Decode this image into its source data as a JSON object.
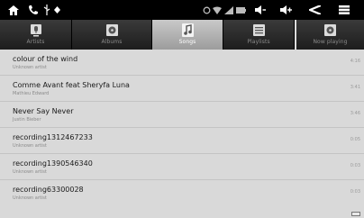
{
  "tabs": [
    {
      "label": "Artists",
      "icon": "microphone-icon"
    },
    {
      "label": "Albums",
      "icon": "album-icon"
    },
    {
      "label": "Songs",
      "icon": "music-note-icon",
      "active": true
    },
    {
      "label": "Playlists",
      "icon": "playlist-icon"
    },
    {
      "label": "Now playing",
      "icon": "now-playing-icon"
    }
  ],
  "songs": [
    {
      "title": "colour of the wind",
      "artist": "Unknown artist",
      "duration": "4:16"
    },
    {
      "title": "Comme Avant feat Sheryfa Luna",
      "artist": "Mathieu Edward",
      "duration": "3:41"
    },
    {
      "title": "Never Say Never",
      "artist": "Justin Bieber",
      "duration": "3:46"
    },
    {
      "title": "recording1312467233",
      "artist": "Unknown artist",
      "duration": "0:05"
    },
    {
      "title": "recording1390546340",
      "artist": "Unknown artist",
      "duration": "0:03"
    },
    {
      "title": "recording63300028",
      "artist": "Unknown artist",
      "duration": "0:03"
    }
  ],
  "colors": {
    "status_bar": "#000000",
    "tab_bar": "#2a2a2a",
    "tab_active": "#b5b5b5",
    "list_bg": "#d9d9d9"
  }
}
